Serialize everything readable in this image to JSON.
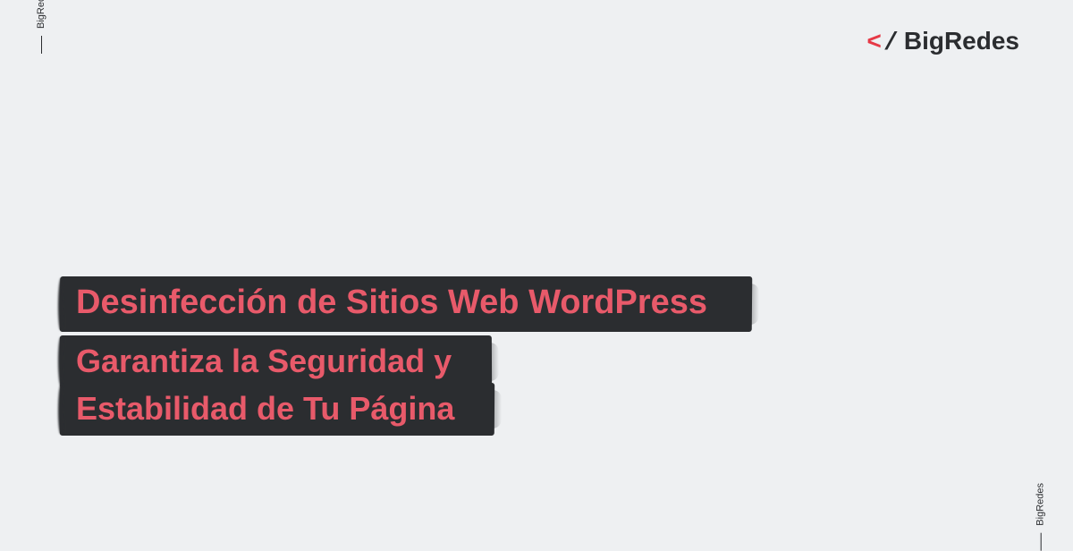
{
  "logo": {
    "bracket": "<",
    "slash": "/",
    "text": "BigRedes"
  },
  "brand_label": "BigRedes",
  "headings": {
    "title": "Desinfección de Sitios Web WordPress",
    "subtitle_line1": "Garantiza la Seguridad y",
    "subtitle_line2": "Estabilidad de Tu Página"
  },
  "colors": {
    "accent": "#e63946",
    "text_dark": "#2b2d30",
    "bg": "#eef0f2",
    "heading_text": "#e85a6a"
  }
}
